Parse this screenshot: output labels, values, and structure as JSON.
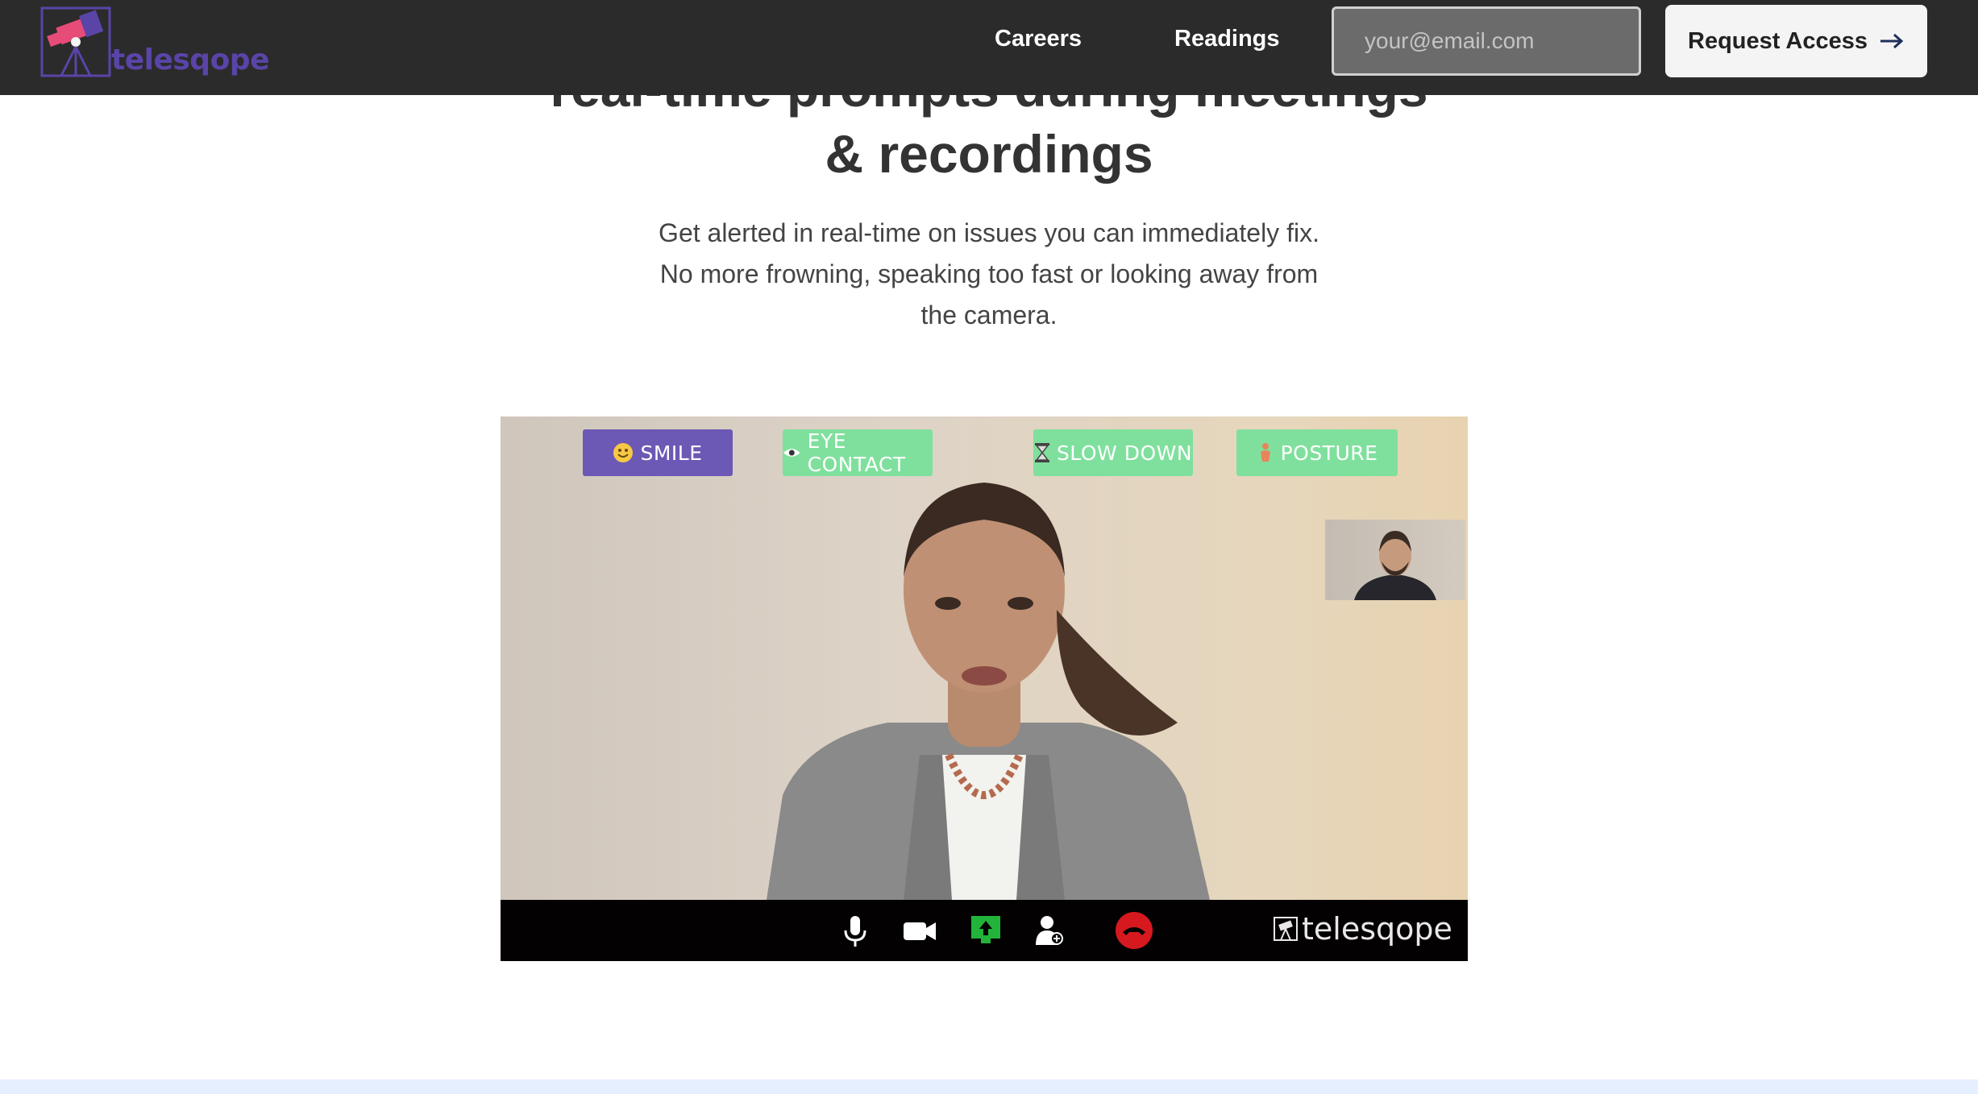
{
  "header": {
    "logo_text": "telesqope",
    "nav": [
      "Careers",
      "Readings"
    ],
    "email_placeholder": "your@email.com",
    "cta_label": "Request Access",
    "cta_icon": "arrow-right-icon"
  },
  "hero": {
    "title_line1": "real-time prompts during meetings",
    "title_line2": "& recordings",
    "subtitle_lines": [
      "Get alerted in real-time on issues you can immediately fix.",
      "No more frowning, speaking too fast or looking away from",
      "the camera."
    ]
  },
  "video": {
    "prompts": [
      {
        "label": "SMILE",
        "icon": "smile-icon",
        "active": true
      },
      {
        "label": "EYE CONTACT",
        "icon": "eye-icon",
        "active": false
      },
      {
        "label": "SLOW DOWN",
        "icon": "hourglass-icon",
        "active": false
      },
      {
        "label": "POSTURE",
        "icon": "posture-icon",
        "active": false
      }
    ],
    "controls": [
      "microphone-icon",
      "camera-icon",
      "share-screen-icon",
      "add-person-icon",
      "end-call-icon"
    ],
    "watermark": "telesqope",
    "colors": {
      "smile_bg": "#6c58b5",
      "prompt_green": "#7fe09d",
      "end_call": "#d6191f",
      "share_green": "#22b33a"
    }
  }
}
